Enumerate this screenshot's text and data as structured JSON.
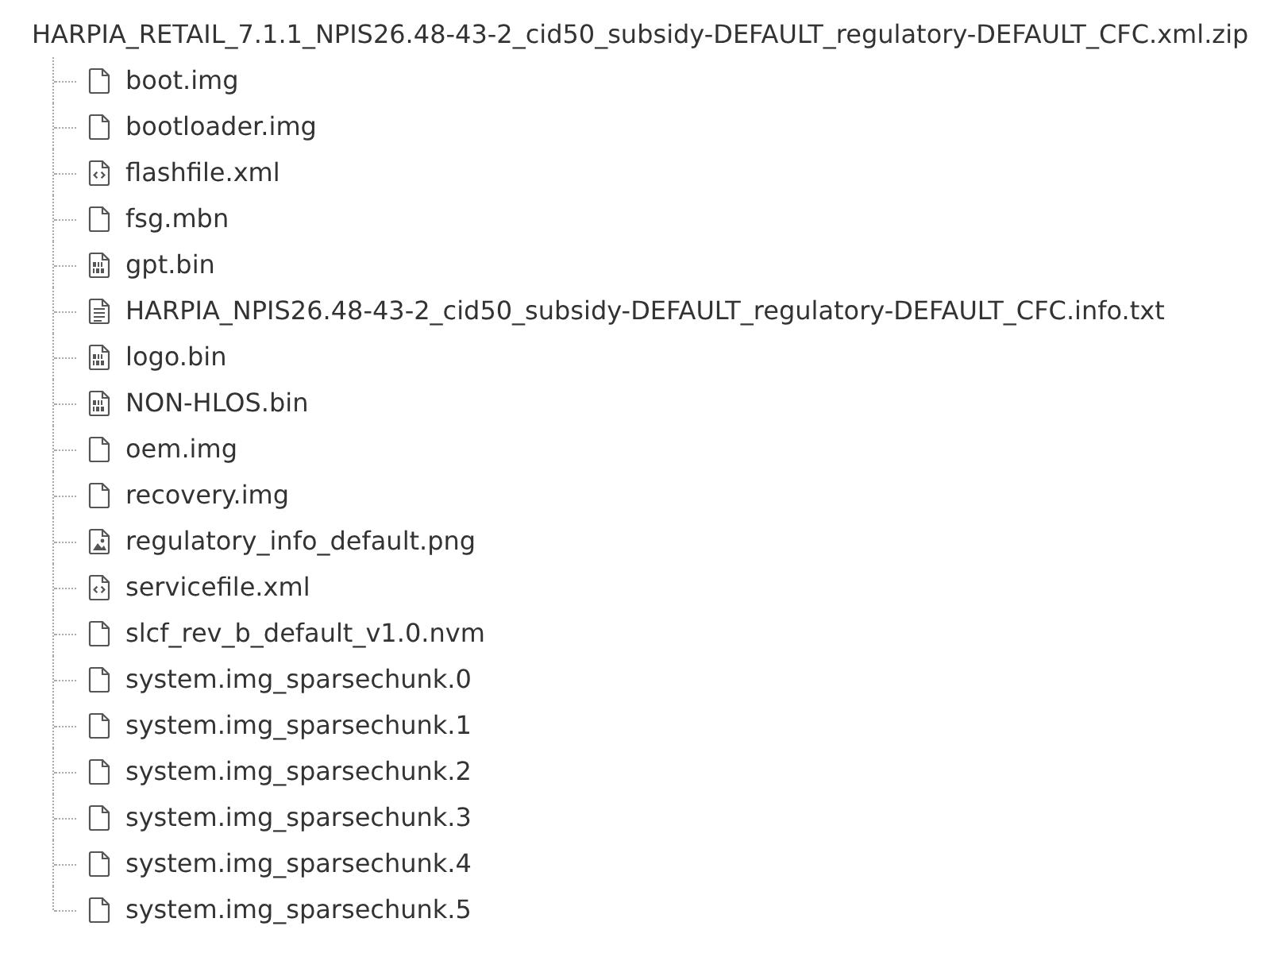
{
  "archive": {
    "name": "HARPIA_RETAIL_7.1.1_NPIS26.48-43-2_cid50_subsidy-DEFAULT_regulatory-DEFAULT_CFC.xml.zip",
    "children": [
      {
        "name": "boot.img",
        "kind": "file"
      },
      {
        "name": "bootloader.img",
        "kind": "file"
      },
      {
        "name": "flashfile.xml",
        "kind": "code"
      },
      {
        "name": "fsg.mbn",
        "kind": "file"
      },
      {
        "name": "gpt.bin",
        "kind": "binary"
      },
      {
        "name": "HARPIA_NPIS26.48-43-2_cid50_subsidy-DEFAULT_regulatory-DEFAULT_CFC.info.txt",
        "kind": "text"
      },
      {
        "name": "logo.bin",
        "kind": "binary"
      },
      {
        "name": "NON-HLOS.bin",
        "kind": "binary"
      },
      {
        "name": "oem.img",
        "kind": "file"
      },
      {
        "name": "recovery.img",
        "kind": "file"
      },
      {
        "name": "regulatory_info_default.png",
        "kind": "image"
      },
      {
        "name": "servicefile.xml",
        "kind": "code"
      },
      {
        "name": "slcf_rev_b_default_v1.0.nvm",
        "kind": "file"
      },
      {
        "name": "system.img_sparsechunk.0",
        "kind": "file"
      },
      {
        "name": "system.img_sparsechunk.1",
        "kind": "file"
      },
      {
        "name": "system.img_sparsechunk.2",
        "kind": "file"
      },
      {
        "name": "system.img_sparsechunk.3",
        "kind": "file"
      },
      {
        "name": "system.img_sparsechunk.4",
        "kind": "file"
      },
      {
        "name": "system.img_sparsechunk.5",
        "kind": "file"
      }
    ]
  }
}
